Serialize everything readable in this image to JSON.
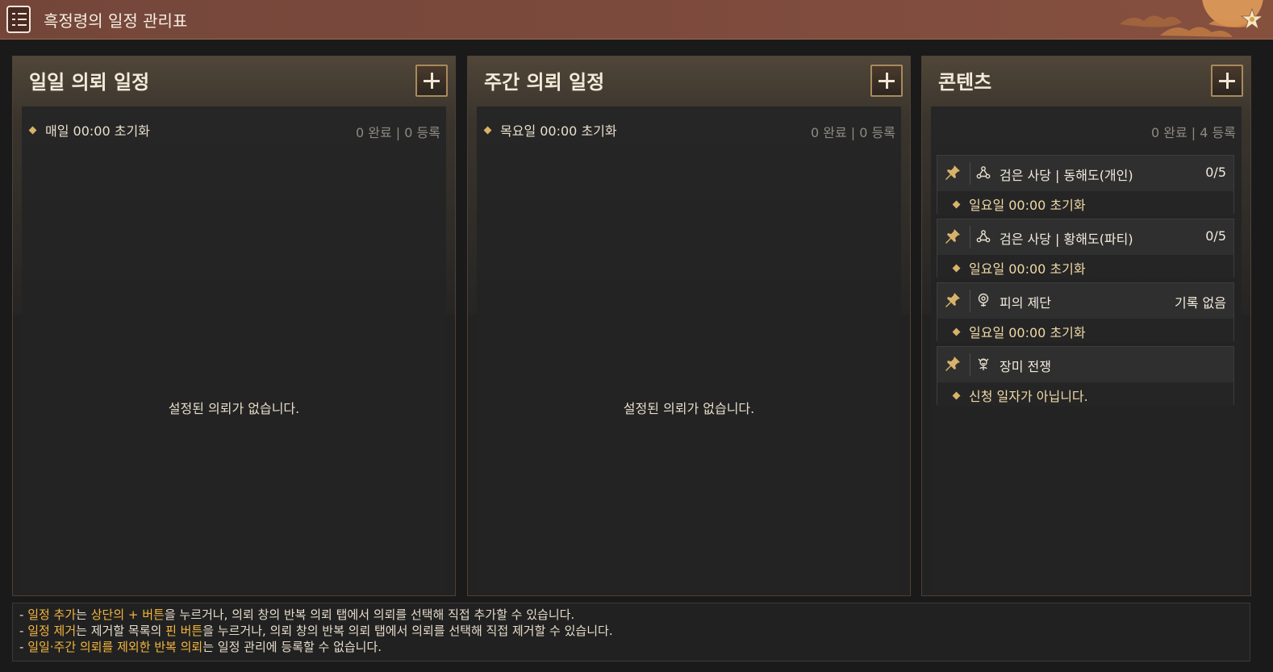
{
  "window": {
    "title": "흑정령의 일정 관리표",
    "icons": {
      "title": "schedule-list-icon",
      "emblem": "flower-emblem-icon"
    }
  },
  "colors": {
    "title_bar": "#7c4a3d",
    "accent_gold": "#d9b26a",
    "highlight": "#f4b63e",
    "panel_bg": "#222222"
  },
  "panels": [
    {
      "title": "일일 의뢰 일정",
      "reset": "매일 00:00 초기화",
      "count": "0 완료 | 0 등록",
      "empty_message": "설정된 의뢰가 없습니다.",
      "add_icon": "plus-icon"
    },
    {
      "title": "주간 의뢰 일정",
      "reset": "목요일 00:00 초기화",
      "count": "0 완료 | 0 등록",
      "empty_message": "설정된 의뢰가 없습니다.",
      "add_icon": "plus-icon"
    },
    {
      "title": "콘텐츠",
      "count": "0 완료 | 4 등록",
      "add_icon": "plus-icon",
      "items": [
        {
          "name": "검은 사당 | 동해도(개인)",
          "status": "0/5",
          "reset": "일요일 00:00 초기화",
          "icon": "black-shrine-icon"
        },
        {
          "name": "검은 사당 | 황해도(파티)",
          "status": "0/5",
          "reset": "일요일 00:00 초기화",
          "icon": "black-shrine-icon"
        },
        {
          "name": "피의 제단",
          "status": "기록 없음",
          "reset": "일요일 00:00 초기화",
          "icon": "blood-altar-icon"
        },
        {
          "name": "장미 전쟁",
          "status": "",
          "reset": "신청 일자가 아닙니다.",
          "icon": "rose-war-icon"
        }
      ]
    }
  ],
  "help": {
    "line1": {
      "prefix": "- ",
      "hl1": "일정 추가",
      "t1": "는 ",
      "hl2": "상단의 + 버튼",
      "t2": "을 누르거나, 의뢰 창의 반복 의뢰 탭에서 의뢰를 선택해 직접 추가할 수 있습니다."
    },
    "line2": {
      "prefix": "- ",
      "hl1": "일정 제거",
      "t1": "는 제거할 목록의 ",
      "hl2": "핀 버튼",
      "t2": "을 누르거나, 의뢰 창의 반복 의뢰 탭에서 의뢰를 선택해 직접 제거할 수 있습니다."
    },
    "line3": {
      "prefix": "- ",
      "hl1": "일일·주간 의뢰를 제외한 반복 의뢰",
      "t1": "는 일정 관리에 등록할 수 없습니다."
    }
  }
}
